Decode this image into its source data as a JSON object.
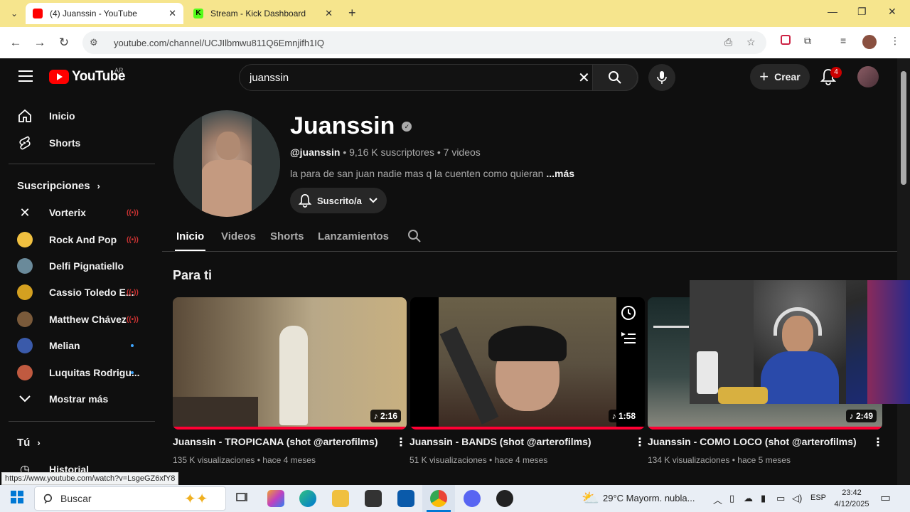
{
  "browser": {
    "tabs": [
      {
        "title": "(4) Juanssin - YouTube",
        "active": true,
        "favicon_color": "#ff0000"
      },
      {
        "title": "Stream - Kick Dashboard",
        "active": false,
        "favicon_color": "#53fc18"
      }
    ],
    "url": "youtube.com/channel/UCJIlbmwu811Q6Emnjifh1IQ"
  },
  "header": {
    "logo_text": "YouTube",
    "country_code": "AR",
    "search_value": "juanssin",
    "create_label": "Crear",
    "notifications_count": "4"
  },
  "sidebar": {
    "main": [
      {
        "label": "Inicio",
        "icon": "home-icon"
      },
      {
        "label": "Shorts",
        "icon": "shorts-icon"
      }
    ],
    "subscriptions_title": "Suscripciones",
    "subscriptions": [
      {
        "label": "Vorterix",
        "status": "live",
        "color": "#e8e8e8"
      },
      {
        "label": "Rock And Pop",
        "status": "live",
        "color": "#f0c040"
      },
      {
        "label": "Delfi Pignatiello",
        "status": "",
        "color": "#6a8a9a"
      },
      {
        "label": "Cassio Toledo E...",
        "status": "live",
        "color": "#d4a020"
      },
      {
        "label": "Matthew Chávez",
        "status": "live",
        "color": "#7a5a3a"
      },
      {
        "label": "Melian",
        "status": "new",
        "color": "#3a5aaa"
      },
      {
        "label": "Luquitas Rodrigu...",
        "status": "new",
        "color": "#c05a40"
      }
    ],
    "show_more": "Mostrar más",
    "you_title": "Tú",
    "history": "Historial"
  },
  "channel": {
    "name": "Juanssin",
    "handle": "@juanssin",
    "stats": " • 9,16 K suscriptores • 7 videos",
    "description": "la para de san juan nadie mas q la cuenten como quieran",
    "more": " ...más",
    "subscribe_label": "Suscrito/a",
    "tabs": [
      "Inicio",
      "Videos",
      "Shorts",
      "Lanzamientos"
    ],
    "section_title": "Para ti"
  },
  "videos": [
    {
      "title": "Juanssin - TROPICANA (shot @arterofilms)",
      "meta": "135 K visualizaciones • hace 4 meses",
      "duration": "2:16"
    },
    {
      "title": "Juanssin - BANDS (shot @arterofilms)",
      "meta": "51 K visualizaciones • hace 4 meses",
      "duration": "1:58"
    },
    {
      "title": "Juanssin - COMO LOCO (shot @arterofilms)",
      "meta": "134 K visualizaciones • hace 5 meses",
      "duration": "2:49"
    }
  ],
  "status_link": "https://www.youtube.com/watch?v=LsgeGZ6xfY8",
  "taskbar": {
    "search_label": "Buscar",
    "weather": "29°C  Mayorm. nubla...",
    "language": "ESP",
    "time": "23:42",
    "date": "4/12/2025"
  }
}
